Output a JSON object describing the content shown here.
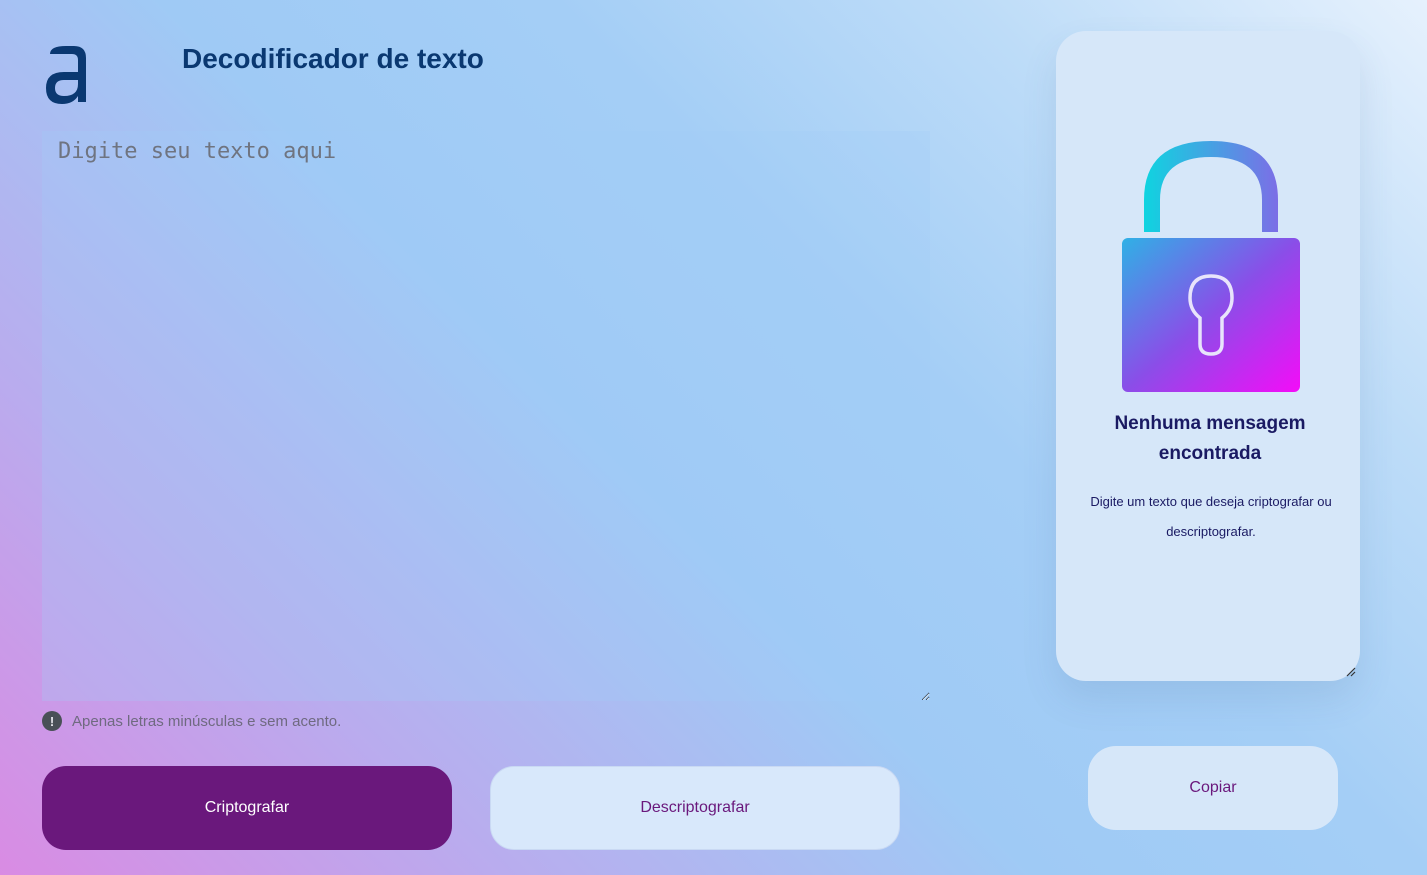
{
  "header": {
    "logo_icon": "alura-a-logo-icon",
    "title": "Decodificador de texto"
  },
  "editor": {
    "placeholder": "Digite seu texto aqui",
    "value": ""
  },
  "hint": {
    "icon": "exclamation-circle-icon",
    "text": "Apenas letras minúsculas e sem acento."
  },
  "actions": {
    "encrypt_label": "Criptografar",
    "decrypt_label": "Descriptografar"
  },
  "output_panel": {
    "icon": "padlock-icon",
    "title": "Nenhuma mensagem encontrada",
    "text": "Digite um texto que deseja criptografar ou descriptografar.",
    "copy_label": "Copiar"
  },
  "colors": {
    "primary": "#6a187c",
    "title": "#0a3871",
    "panel_background": "#d6e7f9",
    "panel_text": "#1a1a63"
  }
}
